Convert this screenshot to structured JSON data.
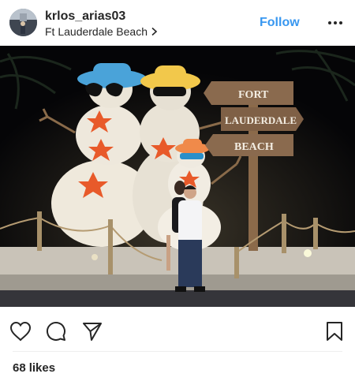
{
  "post": {
    "username": "krlos_arias03",
    "location": "Ft Lauderdale Beach",
    "follow_label": "Follow",
    "likes_count": "68",
    "likes_label": "likes"
  },
  "photo": {
    "sign_lines": [
      "FORT",
      "LAUDERDALE",
      "BEACH"
    ]
  },
  "icons": {
    "more": "more-options-icon",
    "like": "heart-icon",
    "comment": "comment-bubble-icon",
    "share": "paper-plane-icon",
    "save": "bookmark-icon",
    "location": "chevron-right-icon"
  },
  "colors": {
    "accent": "#3897f0",
    "text": "#262626",
    "divider": "#efefef"
  }
}
